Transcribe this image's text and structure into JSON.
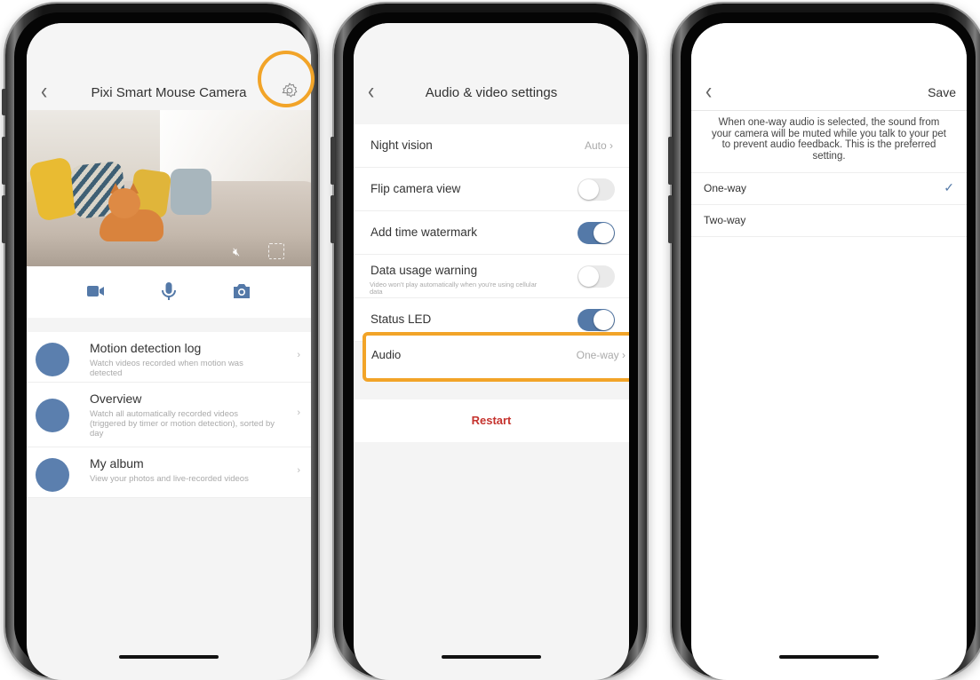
{
  "screen1": {
    "title": "Pixi Smart Mouse Camera",
    "features": [
      {
        "title": "Motion detection log",
        "desc": "Watch videos recorded when motion was detected"
      },
      {
        "title": "Overview",
        "desc": "Watch all automatically recorded videos (triggered by timer or motion detection), sorted by day"
      },
      {
        "title": "My album",
        "desc": "View your photos and live-recorded videos"
      }
    ],
    "icons": [
      "back-icon",
      "gear-icon",
      "mute-icon",
      "fullscreen-icon",
      "video-camera-icon",
      "microphone-icon",
      "camera-icon",
      "chevron-right-icon"
    ]
  },
  "screen2": {
    "title": "Audio & video settings",
    "rows": [
      {
        "label": "Night vision",
        "value": "Auto"
      },
      {
        "label": "Flip camera view",
        "toggle": false
      },
      {
        "label": "Add time watermark",
        "toggle": true
      },
      {
        "label": "Data usage warning",
        "sub": "Video won't play automatically when you're using cellular data",
        "toggle": false
      },
      {
        "label": "Status LED",
        "toggle": true
      }
    ],
    "audio": {
      "label": "Audio",
      "value": "One-way"
    },
    "restart": "Restart"
  },
  "screen3": {
    "save": "Save",
    "notice": "When one-way audio is selected, the sound from your camera will be muted while you talk to your pet to prevent audio feedback. This is the preferred setting.",
    "options": [
      {
        "label": "One-way",
        "selected": true
      },
      {
        "label": "Two-way",
        "selected": false
      }
    ]
  },
  "colors": {
    "accent": "#5479a8",
    "highlight": "#f2a428",
    "restart": "#c5332e"
  }
}
